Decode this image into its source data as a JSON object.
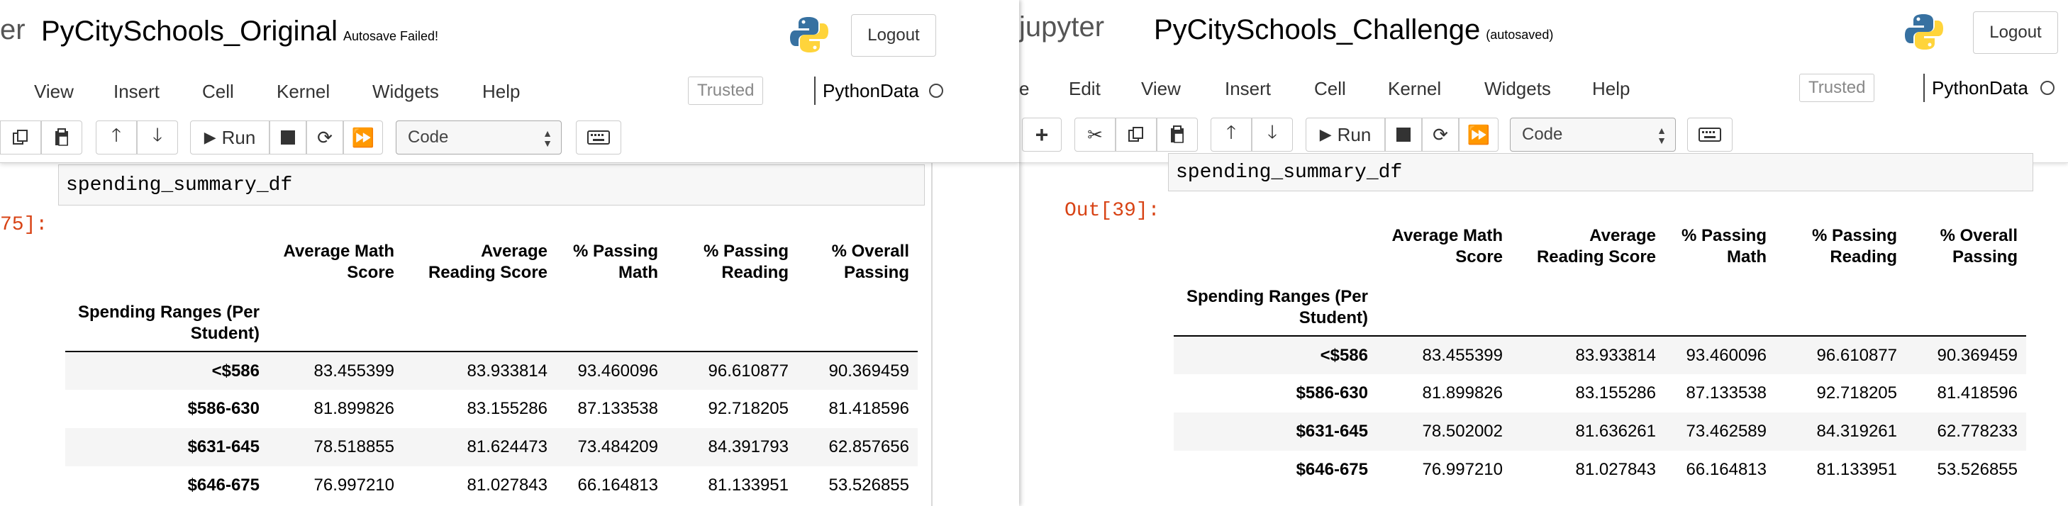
{
  "left": {
    "brand": "er",
    "notebook_name": "PyCitySchools_Original",
    "save_status": "Autosave Failed!",
    "logout": "Logout",
    "menu": [
      "View",
      "Insert",
      "Cell",
      "Kernel",
      "Widgets",
      "Help"
    ],
    "trusted": "Trusted",
    "kernel_name": "PythonData",
    "run_label": "Run",
    "cell_type": "Code",
    "code": "spending_summary_df",
    "out_prompt": "75]:",
    "table": {
      "columns": [
        "Average Math Score",
        "Average Reading Score",
        "% Passing Math",
        "% Passing Reading",
        "% Overall Passing"
      ],
      "col_lines": [
        [
          "Average Math",
          "Score"
        ],
        [
          "Average",
          "Reading Score"
        ],
        [
          "% Passing",
          "Math"
        ],
        [
          "% Passing",
          "Reading"
        ],
        [
          "% Overall",
          "Passing"
        ]
      ],
      "index_name": [
        "Spending Ranges (Per",
        "Student)"
      ],
      "rows": [
        {
          "label": "<$586",
          "values": [
            "83.455399",
            "83.933814",
            "93.460096",
            "96.610877",
            "90.369459"
          ]
        },
        {
          "label": "$586-630",
          "values": [
            "81.899826",
            "83.155286",
            "87.133538",
            "92.718205",
            "81.418596"
          ]
        },
        {
          "label": "$631-645",
          "values": [
            "78.518855",
            "81.624473",
            "73.484209",
            "84.391793",
            "62.857656"
          ]
        },
        {
          "label": "$646-675",
          "values": [
            "76.997210",
            "81.027843",
            "66.164813",
            "81.133951",
            "53.526855"
          ]
        }
      ]
    }
  },
  "right": {
    "brand": "jupyter",
    "notebook_name": "PyCitySchools_Challenge",
    "save_status": "(autosaved)",
    "logout": "Logout",
    "menu": [
      "e",
      "Edit",
      "View",
      "Insert",
      "Cell",
      "Kernel",
      "Widgets",
      "Help"
    ],
    "trusted": "Trusted",
    "kernel_name": "PythonData",
    "run_label": "Run",
    "cell_type": "Code",
    "code": "spending_summary_df",
    "out_prompt": "Out[39]:",
    "table": {
      "col_lines": [
        [
          "Average Math",
          "Score"
        ],
        [
          "Average",
          "Reading Score"
        ],
        [
          "% Passing",
          "Math"
        ],
        [
          "% Passing",
          "Reading"
        ],
        [
          "% Overall",
          "Passing"
        ]
      ],
      "index_name": [
        "Spending Ranges (Per",
        "Student)"
      ],
      "rows": [
        {
          "label": "<$586",
          "values": [
            "83.455399",
            "83.933814",
            "93.460096",
            "96.610877",
            "90.369459"
          ]
        },
        {
          "label": "$586-630",
          "values": [
            "81.899826",
            "83.155286",
            "87.133538",
            "92.718205",
            "81.418596"
          ]
        },
        {
          "label": "$631-645",
          "values": [
            "78.502002",
            "81.636261",
            "73.462589",
            "84.319261",
            "62.778233"
          ]
        },
        {
          "label": "$646-675",
          "values": [
            "76.997210",
            "81.027843",
            "66.164813",
            "81.133951",
            "53.526855"
          ]
        }
      ]
    }
  },
  "icons": {
    "python_logo_blue": "#3771a1",
    "python_logo_yellow": "#ffd43b",
    "out_prompt_color": "#d84315"
  }
}
